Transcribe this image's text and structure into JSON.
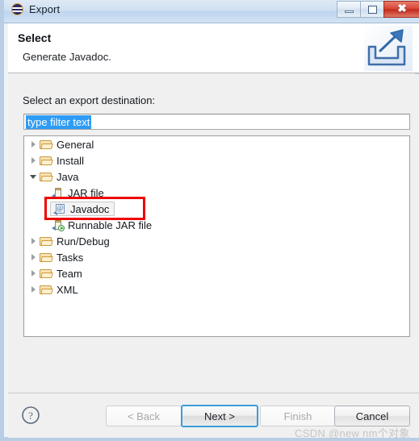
{
  "window": {
    "title": "Export",
    "icon": "eclipse-icon",
    "controls": {
      "minimize": "minimize-icon",
      "maximize": "maximize-icon",
      "close": "close-icon"
    }
  },
  "header": {
    "title": "Select",
    "description": "Generate Javadoc.",
    "banner_icon": "export-arrow-icon"
  },
  "main": {
    "destination_label": "Select an export destination:",
    "filter": {
      "value": "type filter text",
      "selected": true,
      "selection_color": "#2e9cf5"
    },
    "tree": [
      {
        "label": "General",
        "icon": "folder-icon",
        "level": 0,
        "state": "collapsed",
        "selected": false
      },
      {
        "label": "Install",
        "icon": "folder-icon",
        "level": 0,
        "state": "collapsed",
        "selected": false
      },
      {
        "label": "Java",
        "icon": "folder-icon",
        "level": 0,
        "state": "expanded",
        "selected": false
      },
      {
        "label": "JAR file",
        "icon": "jar-icon",
        "level": 1,
        "state": "leaf",
        "selected": false
      },
      {
        "label": "Javadoc",
        "icon": "javadoc-icon",
        "level": 1,
        "state": "leaf",
        "selected": true
      },
      {
        "label": "Runnable JAR file",
        "icon": "runnable-jar-icon",
        "level": 1,
        "state": "leaf",
        "selected": false
      },
      {
        "label": "Run/Debug",
        "icon": "folder-icon",
        "level": 0,
        "state": "collapsed",
        "selected": false
      },
      {
        "label": "Tasks",
        "icon": "folder-icon",
        "level": 0,
        "state": "collapsed",
        "selected": false
      },
      {
        "label": "Team",
        "icon": "folder-icon",
        "level": 0,
        "state": "collapsed",
        "selected": false
      },
      {
        "label": "XML",
        "icon": "folder-icon",
        "level": 0,
        "state": "collapsed",
        "selected": false
      }
    ],
    "annotation": {
      "shape": "rectangle",
      "color": "#ee0000",
      "targets": "Javadoc"
    }
  },
  "footer": {
    "help_icon": "help-question-icon",
    "buttons": [
      {
        "label": "< Back",
        "enabled": false,
        "default": false
      },
      {
        "label": "Next >",
        "enabled": true,
        "default": true
      },
      {
        "label": "Finish",
        "enabled": false,
        "default": false
      },
      {
        "label": "Cancel",
        "enabled": true,
        "default": false
      }
    ],
    "watermark": "CSDN @new nm个对象"
  }
}
